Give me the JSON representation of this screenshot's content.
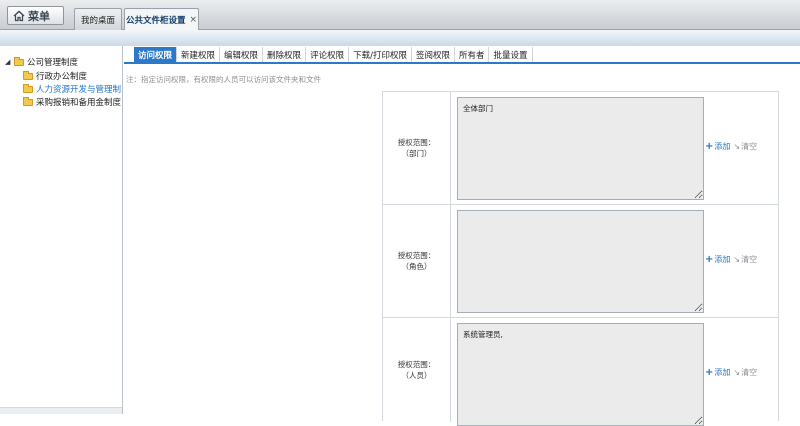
{
  "topbar": {
    "menu_label": "菜单",
    "tabs": [
      {
        "label": "我的桌面"
      },
      {
        "label": "公共文件柜设置",
        "close": "×"
      }
    ]
  },
  "tree": {
    "root": {
      "toggle": "◢",
      "label": "公司管理制度"
    },
    "children": [
      {
        "label": "行政办公制度"
      },
      {
        "label": "人力资源开发与管理制"
      },
      {
        "label": "采购报销和备用金制度"
      }
    ]
  },
  "subtabs": [
    "访问权限",
    "新建权限",
    "编辑权限",
    "删除权限",
    "评论权限",
    "下载/打印权限",
    "签阅权限",
    "所有者",
    "批量设置"
  ],
  "note": "注：指定访问权限，有权限的人员可以访问该文件夹和文件",
  "permissions": [
    {
      "label_line1": "授权范围：",
      "label_line2": "（部门）",
      "value": "全体部门"
    },
    {
      "label_line1": "授权范围：",
      "label_line2": "（角色）",
      "value": ""
    },
    {
      "label_line1": "授权范围：",
      "label_line2": "（人员）",
      "value": "系统管理员,"
    }
  ],
  "actions": {
    "add": "添加",
    "clear": "清空"
  },
  "colors": {
    "accent": "#2d78c7",
    "link": "#1f73c2",
    "folder": "#f2c94c"
  }
}
